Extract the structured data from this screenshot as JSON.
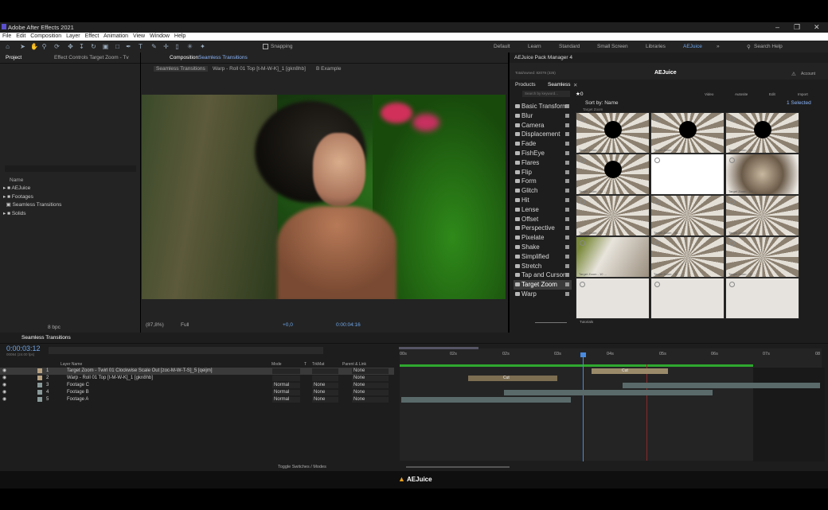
{
  "app": {
    "title": "Adobe After Effects 2021"
  },
  "menu": [
    "File",
    "Edit",
    "Composition",
    "Layer",
    "Effect",
    "Animation",
    "View",
    "Window",
    "Help"
  ],
  "toolbar": {
    "snapping_label": "Snapping"
  },
  "workspaces": [
    "Default",
    "Learn",
    "Standard",
    "Small Screen",
    "Libraries",
    "AEJuice"
  ],
  "search_help": "Search Help",
  "project_panel": {
    "tab_project": "Project",
    "tab_effect_controls": "Effect Controls Target Zoom - Tv",
    "name_header": "Name",
    "items": [
      "AEJuice",
      "Footages",
      "Seamless Transitions",
      "Solids"
    ],
    "bpc": "8 bpc"
  },
  "composition_panel": {
    "tab": "Composition",
    "tab_name": "Seamless Transitions",
    "breadcrumbs": [
      "Seamless Transitions",
      "Warp - Roll 01 Top [t-M-W-K]_1 [gkn8hb]",
      "B Example"
    ],
    "zoom": "(87,8%)",
    "resolution": "Full",
    "exposure": "+0,0",
    "timecode": "0:00:04:16"
  },
  "pack_manager": {
    "title": "AEJuice Pack Manager 4",
    "tabs": [
      "Products",
      "Seamless"
    ],
    "brand": "AEJuice",
    "account": "Account",
    "total": "Total/owned: 82079 (326)",
    "actions": [
      "Video",
      "Autosite",
      "Edit",
      "Import"
    ],
    "search_placeholder": "Search by keyword...",
    "favorites": "0",
    "sort_label": "Sort by: Name",
    "selected": "1 Selected",
    "folder": "Target Zoom",
    "categories": [
      "Basic Transform",
      "Blur",
      "Camera",
      "Displacement",
      "Fade",
      "FishEye",
      "Flares",
      "Flip",
      "Form",
      "Glitch",
      "Hit",
      "Lense",
      "Offset",
      "Perspective",
      "Pixelate",
      "Shake",
      "Simplified",
      "Stretch",
      "Tap and Cursor",
      "Target Zoom",
      "Warp"
    ],
    "selected_category": "Target Zoom",
    "thumb_labels": [
      "Target Zoom - 01 ...",
      "Target Zoom - 02 ...",
      "Target Zoom - 03 ...",
      "Target Zoom - 04 ...",
      "",
      "Target Zoom - 06 ...",
      "Target Zoom - 07 ...",
      "Target Zoom - 08 ...",
      "Target Zoom - 09 ...",
      "Target Zoom - 10 ...",
      "Target Zoom - 11 ...",
      "Target Zoom - 12 ...",
      "",
      "",
      ""
    ],
    "footer_label": "Tutorials"
  },
  "timeline": {
    "tab": "Seamless Transitions",
    "timecode": "0:00:03:12",
    "frame_info": "00084 (24.00 fps)",
    "columns": {
      "layer_name": "Layer Name",
      "mode": "Mode",
      "t": "T",
      "trkmat": "TrkMat",
      "parent": "Parent & Link"
    },
    "layers": [
      {
        "num": "1",
        "name": "Target Zoom - Twirl 01 Clockwise Scale Out [zoc-M-W-T-S]_5 [qeijm]",
        "mode": "",
        "trkmat": "",
        "parent": "None",
        "color": "#b8a282"
      },
      {
        "num": "2",
        "name": "Warp - Roll 01 Top [t-M-W-K]_1 [gkn8hb]",
        "mode": "",
        "trkmat": "",
        "parent": "None",
        "color": "#b8a282"
      },
      {
        "num": "3",
        "name": "Footage C",
        "mode": "Normal",
        "trkmat": "None",
        "parent": "None",
        "color": "#8a9a9a"
      },
      {
        "num": "4",
        "name": "Footage B",
        "mode": "Normal",
        "trkmat": "None",
        "parent": "None",
        "color": "#8a9a9a"
      },
      {
        "num": "5",
        "name": "Footage A",
        "mode": "Normal",
        "trkmat": "None",
        "parent": "None",
        "color": "#8a9a9a"
      }
    ],
    "ruler": [
      "00s",
      "02s",
      "02s",
      "03s",
      "04s",
      "05s",
      "06s",
      "07s",
      "08"
    ],
    "clip_labels": [
      "Cut",
      "Cut"
    ],
    "toggle_label": "Toggle Switches / Modes"
  },
  "footer": {
    "brand": "AEJuice"
  }
}
